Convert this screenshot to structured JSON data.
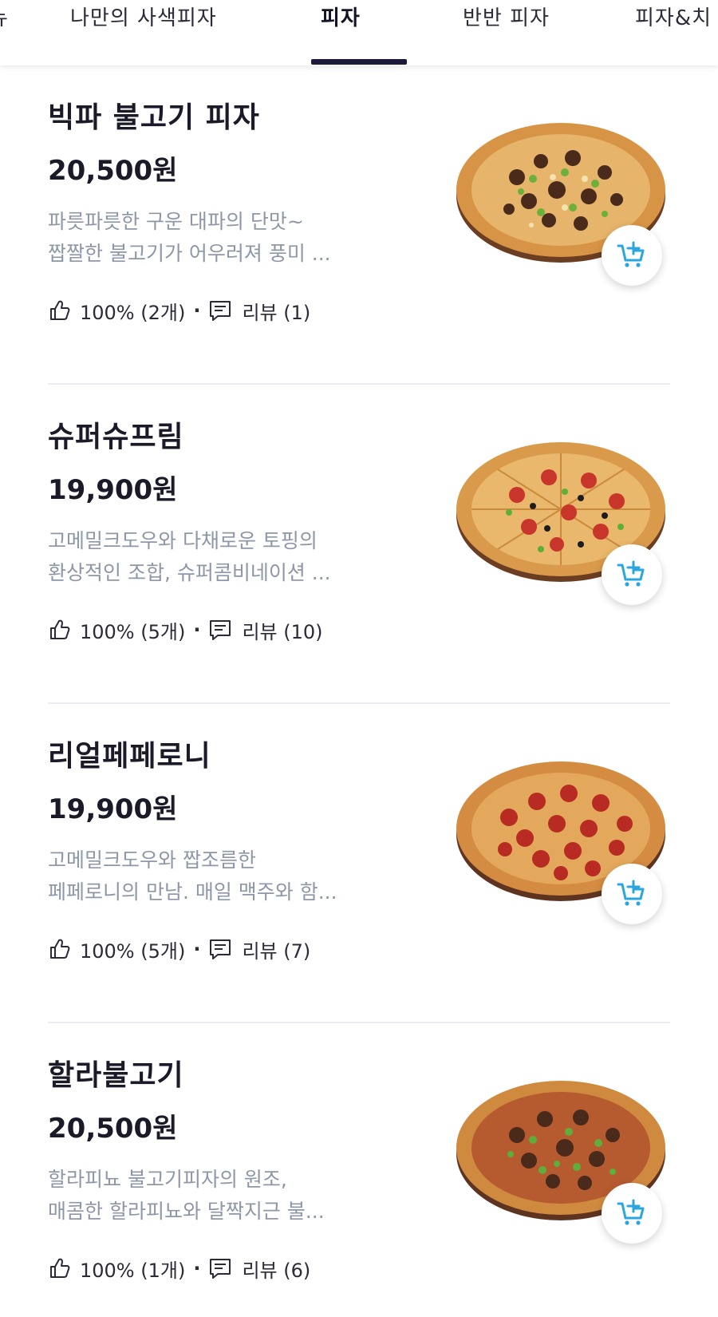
{
  "tabs": [
    {
      "label": "뉴"
    },
    {
      "label": "나만의 사색피자"
    },
    {
      "label": "피자"
    },
    {
      "label": "반반 피자"
    },
    {
      "label": "피자&치"
    }
  ],
  "colors": {
    "accent": "#1c1a3a",
    "cart_icon": "#2aa7e0",
    "desc_text": "#8e97a8"
  },
  "items": [
    {
      "name": "빅파 불고기 피자",
      "price": "20,500원",
      "desc_line1": "파릇파릇한 구운 대파의 단맛~",
      "desc_line2": "짭짤한 불고기가 어우러져 풍미 ...",
      "rating": "100% (2개)",
      "review": "리뷰 (1)",
      "pizza_style": "bulgogi-scallion"
    },
    {
      "name": "슈퍼슈프림",
      "price": "19,900원",
      "desc_line1": "고메밀크도우와 다채로운 토핑의",
      "desc_line2": "환상적인 조합, 슈퍼콤비네이션 ...",
      "rating": "100% (5개)",
      "review": "리뷰 (10)",
      "pizza_style": "supreme"
    },
    {
      "name": "리얼페페로니",
      "price": "19,900원",
      "desc_line1": "고메밀크도우와 짭조름한",
      "desc_line2": "페페로니의 만남. 매일 맥주와 함...",
      "rating": "100% (5개)",
      "review": "리뷰 (7)",
      "pizza_style": "pepperoni"
    },
    {
      "name": "할라불고기",
      "price": "20,500원",
      "desc_line1": "할라피뇨 불고기피자의 원조,",
      "desc_line2": "매콤한 할라피뇨와 달짝지근 불...",
      "rating": "100% (1개)",
      "review": "리뷰 (6)",
      "pizza_style": "jalapeno-bulgogi"
    }
  ]
}
